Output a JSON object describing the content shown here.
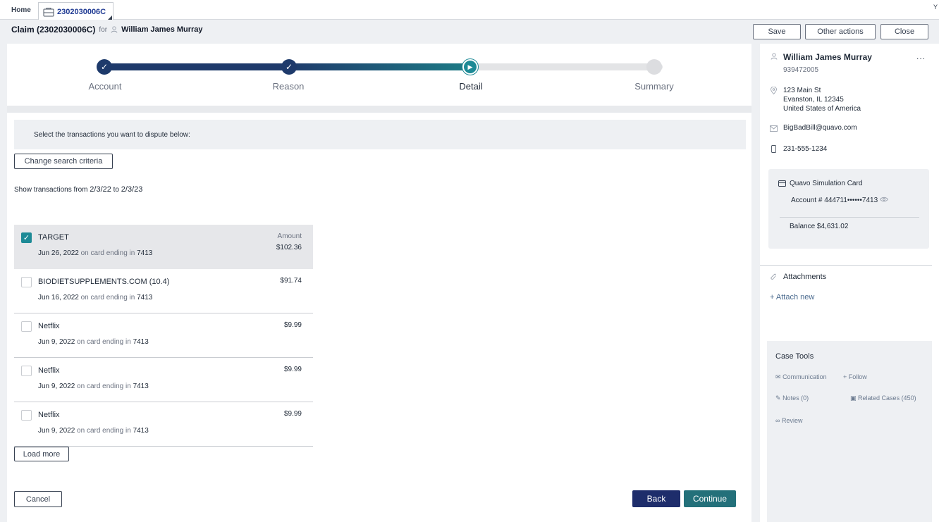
{
  "tabs": {
    "home_label": "Home",
    "case_label": "2302030006C",
    "edge_glyph": "Y"
  },
  "header": {
    "title": "Claim (2302030006C)",
    "for_label": "for",
    "customer": "William James Murray",
    "save_label": "Save",
    "other_actions_label": "Other actions",
    "close_label": "Close"
  },
  "stepper": {
    "steps": [
      {
        "label": "Account",
        "state": "done"
      },
      {
        "label": "Reason",
        "state": "done"
      },
      {
        "label": "Detail",
        "state": "current"
      },
      {
        "label": "Summary",
        "state": "todo"
      }
    ]
  },
  "main": {
    "prompt": "Select the transactions you want to dispute below:",
    "change_criteria_label": "Change search criteria",
    "range_prefix": "Show transactions from",
    "range_from": "2/3/22",
    "range_to_word": "to",
    "range_to": "2/3/23",
    "amount_header": "Amount",
    "card_phrase": "on card ending in",
    "transactions": [
      {
        "merchant": "TARGET",
        "date": "Jun 26, 2022",
        "last4": "7413",
        "amount": "$102.36",
        "selected": true
      },
      {
        "merchant": "BIODIETSUPPLEMENTS.COM (10.4)",
        "date": "Jun 16, 2022",
        "last4": "7413",
        "amount": "$91.74",
        "selected": false
      },
      {
        "merchant": "Netflix",
        "date": "Jun 9, 2022",
        "last4": "7413",
        "amount": "$9.99",
        "selected": false
      },
      {
        "merchant": "Netflix",
        "date": "Jun 9, 2022",
        "last4": "7413",
        "amount": "$9.99",
        "selected": false
      },
      {
        "merchant": "Netflix",
        "date": "Jun 9, 2022",
        "last4": "7413",
        "amount": "$9.99",
        "selected": false
      }
    ],
    "load_more_label": "Load more",
    "cancel_label": "Cancel",
    "back_label": "Back",
    "continue_label": "Continue"
  },
  "sidebar": {
    "name": "William James Murray",
    "more_label": "...",
    "customer_id": "939472005",
    "address_line1": "123 Main St",
    "address_line2": "Evanston, IL 12345",
    "address_line3": "United States of America",
    "email": "BigBadBill@quavo.com",
    "phone": "231-555-1234",
    "card_name": "Quavo Simulation Card",
    "account_label": "Account #",
    "account_number": "444711••••••7413",
    "balance_label": "Balance",
    "balance_value": "$4,631.02",
    "attachments_label": "Attachments",
    "attach_new_label": "Attach new",
    "case_tools_label": "Case Tools",
    "tools": {
      "communication": "Communication",
      "follow": "Follow",
      "notes": "Notes (0)",
      "related": "Related Cases (450)",
      "review": "Review"
    }
  },
  "colors": {
    "primary_navy": "#1e3a6b",
    "accent_teal": "#1d8a96",
    "continue_teal": "#23707a",
    "back_navy": "#1e2d6b"
  }
}
